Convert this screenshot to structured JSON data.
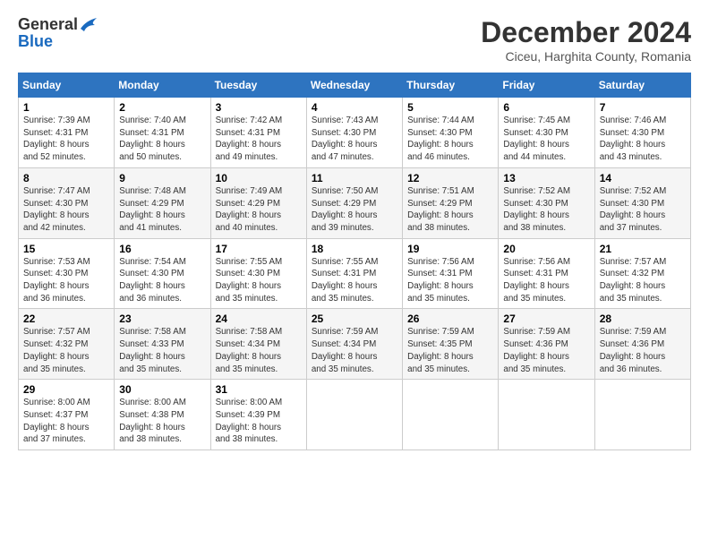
{
  "logo": {
    "general": "General",
    "blue": "Blue"
  },
  "title": "December 2024",
  "subtitle": "Ciceu, Harghita County, Romania",
  "days_header": [
    "Sunday",
    "Monday",
    "Tuesday",
    "Wednesday",
    "Thursday",
    "Friday",
    "Saturday"
  ],
  "weeks": [
    [
      {
        "day": "1",
        "info": "Sunrise: 7:39 AM\nSunset: 4:31 PM\nDaylight: 8 hours\nand 52 minutes."
      },
      {
        "day": "2",
        "info": "Sunrise: 7:40 AM\nSunset: 4:31 PM\nDaylight: 8 hours\nand 50 minutes."
      },
      {
        "day": "3",
        "info": "Sunrise: 7:42 AM\nSunset: 4:31 PM\nDaylight: 8 hours\nand 49 minutes."
      },
      {
        "day": "4",
        "info": "Sunrise: 7:43 AM\nSunset: 4:30 PM\nDaylight: 8 hours\nand 47 minutes."
      },
      {
        "day": "5",
        "info": "Sunrise: 7:44 AM\nSunset: 4:30 PM\nDaylight: 8 hours\nand 46 minutes."
      },
      {
        "day": "6",
        "info": "Sunrise: 7:45 AM\nSunset: 4:30 PM\nDaylight: 8 hours\nand 44 minutes."
      },
      {
        "day": "7",
        "info": "Sunrise: 7:46 AM\nSunset: 4:30 PM\nDaylight: 8 hours\nand 43 minutes."
      }
    ],
    [
      {
        "day": "8",
        "info": "Sunrise: 7:47 AM\nSunset: 4:30 PM\nDaylight: 8 hours\nand 42 minutes."
      },
      {
        "day": "9",
        "info": "Sunrise: 7:48 AM\nSunset: 4:29 PM\nDaylight: 8 hours\nand 41 minutes."
      },
      {
        "day": "10",
        "info": "Sunrise: 7:49 AM\nSunset: 4:29 PM\nDaylight: 8 hours\nand 40 minutes."
      },
      {
        "day": "11",
        "info": "Sunrise: 7:50 AM\nSunset: 4:29 PM\nDaylight: 8 hours\nand 39 minutes."
      },
      {
        "day": "12",
        "info": "Sunrise: 7:51 AM\nSunset: 4:29 PM\nDaylight: 8 hours\nand 38 minutes."
      },
      {
        "day": "13",
        "info": "Sunrise: 7:52 AM\nSunset: 4:30 PM\nDaylight: 8 hours\nand 38 minutes."
      },
      {
        "day": "14",
        "info": "Sunrise: 7:52 AM\nSunset: 4:30 PM\nDaylight: 8 hours\nand 37 minutes."
      }
    ],
    [
      {
        "day": "15",
        "info": "Sunrise: 7:53 AM\nSunset: 4:30 PM\nDaylight: 8 hours\nand 36 minutes."
      },
      {
        "day": "16",
        "info": "Sunrise: 7:54 AM\nSunset: 4:30 PM\nDaylight: 8 hours\nand 36 minutes."
      },
      {
        "day": "17",
        "info": "Sunrise: 7:55 AM\nSunset: 4:30 PM\nDaylight: 8 hours\nand 35 minutes."
      },
      {
        "day": "18",
        "info": "Sunrise: 7:55 AM\nSunset: 4:31 PM\nDaylight: 8 hours\nand 35 minutes."
      },
      {
        "day": "19",
        "info": "Sunrise: 7:56 AM\nSunset: 4:31 PM\nDaylight: 8 hours\nand 35 minutes."
      },
      {
        "day": "20",
        "info": "Sunrise: 7:56 AM\nSunset: 4:31 PM\nDaylight: 8 hours\nand 35 minutes."
      },
      {
        "day": "21",
        "info": "Sunrise: 7:57 AM\nSunset: 4:32 PM\nDaylight: 8 hours\nand 35 minutes."
      }
    ],
    [
      {
        "day": "22",
        "info": "Sunrise: 7:57 AM\nSunset: 4:32 PM\nDaylight: 8 hours\nand 35 minutes."
      },
      {
        "day": "23",
        "info": "Sunrise: 7:58 AM\nSunset: 4:33 PM\nDaylight: 8 hours\nand 35 minutes."
      },
      {
        "day": "24",
        "info": "Sunrise: 7:58 AM\nSunset: 4:34 PM\nDaylight: 8 hours\nand 35 minutes."
      },
      {
        "day": "25",
        "info": "Sunrise: 7:59 AM\nSunset: 4:34 PM\nDaylight: 8 hours\nand 35 minutes."
      },
      {
        "day": "26",
        "info": "Sunrise: 7:59 AM\nSunset: 4:35 PM\nDaylight: 8 hours\nand 35 minutes."
      },
      {
        "day": "27",
        "info": "Sunrise: 7:59 AM\nSunset: 4:36 PM\nDaylight: 8 hours\nand 35 minutes."
      },
      {
        "day": "28",
        "info": "Sunrise: 7:59 AM\nSunset: 4:36 PM\nDaylight: 8 hours\nand 36 minutes."
      }
    ],
    [
      {
        "day": "29",
        "info": "Sunrise: 8:00 AM\nSunset: 4:37 PM\nDaylight: 8 hours\nand 37 minutes."
      },
      {
        "day": "30",
        "info": "Sunrise: 8:00 AM\nSunset: 4:38 PM\nDaylight: 8 hours\nand 38 minutes."
      },
      {
        "day": "31",
        "info": "Sunrise: 8:00 AM\nSunset: 4:39 PM\nDaylight: 8 hours\nand 38 minutes."
      },
      null,
      null,
      null,
      null
    ]
  ]
}
